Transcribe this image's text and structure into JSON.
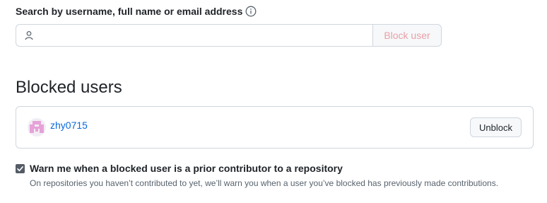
{
  "search": {
    "label": "Search by username, full name or email address",
    "value": "",
    "placeholder": "",
    "block_button_label": "Block user",
    "icons": {
      "info": "info-icon",
      "person": "person-icon"
    }
  },
  "blocked_section": {
    "title": "Blocked users",
    "users": [
      {
        "username": "zhy0715",
        "unblock_label": "Unblock",
        "avatar": "identicon-avatar"
      }
    ]
  },
  "warn_setting": {
    "checked": true,
    "label": "Warn me when a blocked user is a prior contributor to a repository",
    "note": "On repositories you haven’t contributed to yet, we’ll warn you when a user you’ve blocked has previously made contributions."
  },
  "colors": {
    "link": "#0969da",
    "text": "#1f2328",
    "muted": "#59636e",
    "border": "#d0d7de",
    "disabled_button_text": "#e9a0a6",
    "avatar_color": "#e7a1d8"
  }
}
